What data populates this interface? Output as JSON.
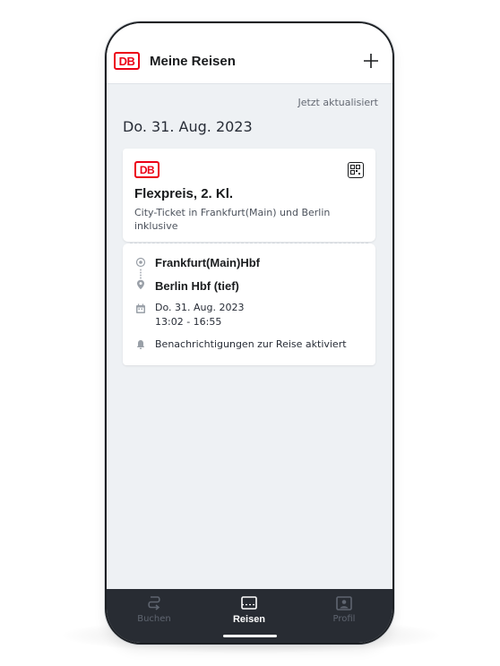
{
  "header": {
    "logo": "DB",
    "title": "Meine Reisen",
    "add_icon": "plus-icon"
  },
  "status": {
    "updated": "Jetzt aktualisiert"
  },
  "trip_date": "Do. 31. Aug. 2023",
  "ticket": {
    "logo": "DB",
    "title": "Flexpreis, 2. Kl.",
    "description": "City-Ticket in Frankfurt(Main) und Berlin inklusive",
    "qr_icon": "qr-code-icon"
  },
  "journey": {
    "origin": "Frankfurt(Main)Hbf",
    "destination": "Berlin Hbf (tief)",
    "date": "Do. 31. Aug. 2023",
    "time": "13:02 - 16:55",
    "notification": "Benachrichtigungen zur Reise aktiviert"
  },
  "nav": {
    "items": [
      {
        "label": "Buchen",
        "icon": "route-icon",
        "active": false
      },
      {
        "label": "Reisen",
        "icon": "ticket-icon",
        "active": true
      },
      {
        "label": "Profil",
        "icon": "profile-icon",
        "active": false
      }
    ]
  },
  "colors": {
    "brand_red": "#ec0016",
    "background": "#eef1f4",
    "nav_background": "#282c33",
    "text_primary": "#1a1c1e",
    "text_secondary": "#646973"
  }
}
